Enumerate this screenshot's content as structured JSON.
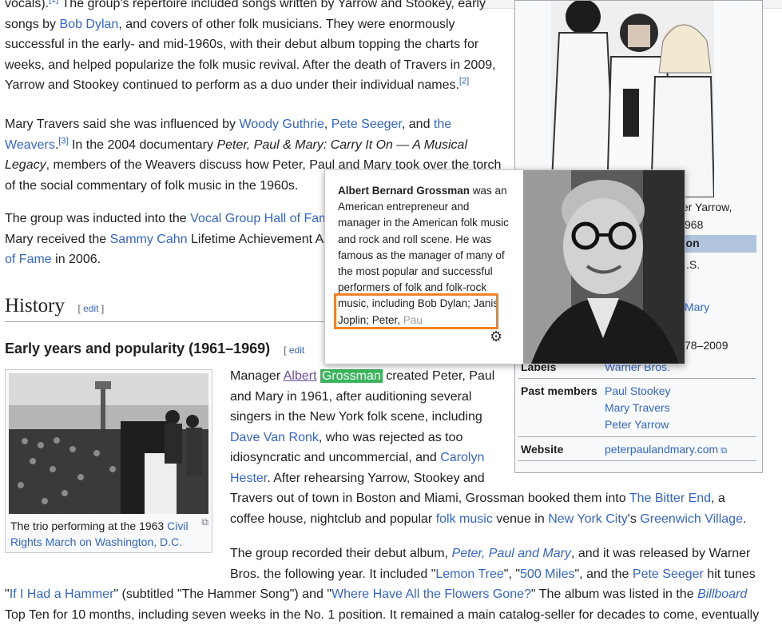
{
  "article": {
    "p1_top": "vocals).",
    "p1_top_rest": "The group's repertoire included songs written by Yarrow and Stookey, early",
    "p1_songs_by": "songs by",
    "p1_bob_dylan": "Bob Dylan",
    "p1_line2_rest": ", and covers of other folk musicians. They were enormously",
    "p1_line3": "successful in the early- and mid-1960s, with their debut album topping the charts for",
    "p1_line4": "weeks, and helped popularize the folk music revival. After the death of Travers in 2009,",
    "p1_line5": "Yarrow and Stookey continued to perform as a duo under their individual names.",
    "ref2": "[2]",
    "p2_start": "Mary Travers said she was influenced by",
    "p2_woody": "Woody Guthrie",
    "p2_comma": ",",
    "p2_pete": "Pete Seeger",
    "p2_and": ", and",
    "p2_the": "the",
    "p2_weavers": "Weavers",
    "ref3": "[3]",
    "p2_line2_rest": " In the 2004 documentary",
    "p2_doc_title": "Peter, Paul & Mary: Carry It On — A Musical",
    "p2_legacy": "Legacy",
    "p2_line3_rest": ", members of the Weavers discuss how Peter, Paul and Mary took over the torch",
    "p2_line4": "of the social commentary of folk music in the 1960s.",
    "p3_start": "The group was inducted into the",
    "p3_vocal": "Vocal Group Hall of Fam",
    "p3_line2_start": "Mary received the",
    "p3_sammy": "Sammy Cahn",
    "p3_line2_rest": " Lifetime Achievement A",
    "p3_of_fame": "of Fame",
    "p3_line3_rest": " in 2006.",
    "history_heading": "History",
    "edit_label": "edit",
    "subheading": "Early years and popularity (1961–1969)",
    "p4_manager": "Manager",
    "p4_albert": "Albert",
    "p4_grossman": "Grossman",
    "p4_line1_rest": " created Peter, Paul",
    "p4_line2": "and Mary in 1961, after auditioning several",
    "p4_line3": "singers in the New York folk scene, including",
    "p4_dave": "Dave Van Ronk",
    "p4_line4_rest": ", who was rejected as too",
    "p4_line5": "idiosyncratic and uncommercial, and",
    "p4_carolyn": "Carolyn",
    "p4_hester": "Hester",
    "p4_line6_rest": ". After rehearsing Yarrow, Stookey and",
    "p4_line7_start": "Travers out of town in Boston and Miami, Grossman booked them into",
    "p4_bitter": "The Bitter End",
    "p4_line7_end": ", a",
    "p4_line8_start": "coffee house, nightclub and popular",
    "p4_folk": "folk music",
    "p4_venue": " venue in",
    "p4_nyc": "New York City",
    "p4_s": "'s",
    "p4_greenwich": "Greenwich Village",
    "p4_dot": ".",
    "p5_start": "The group recorded their debut album,",
    "p5_album": "Peter, Paul and Mary",
    "p5_line1_rest": ", and it was released by Warner",
    "p5_line2_start": "Bros. the following year. It included \"",
    "p5_lemon": "Lemon Tree",
    "p5_q1": "\", \"",
    "p5_500": "500 Miles",
    "p5_q2": "\", and the",
    "p5_pete": "Pete Seeger",
    "p5_hit": " hit tunes",
    "p5_q3": "\"",
    "p5_hammer": "If I Had a Hammer",
    "p5_sub": "\" (subtitled \"The Hammer Song\") and \"",
    "p5_flowers": "Where Have All the Flowers Gone?",
    "p5_q4": "\" The album was listed in the",
    "p5_billboard": "Billboard",
    "p5_line4": "Top Ten for 10 months, including seven weeks in the No. 1 position. It remained a main catalog-seller for decades to come, eventually"
  },
  "thumb": {
    "caption_start": "The trio performing at the 1963",
    "caption_link": "Civil Rights March on Washington, D.C.",
    "magnify_icon": "magnify-clip"
  },
  "infobox": {
    "caption_frag1": "ter Yarrow,",
    "caption_frag2": "968",
    "section_frag": "tion",
    "frag_s": ".S.",
    "frag_mary": "Mary",
    "frag_years": "78–2009",
    "labels_label": "Labels",
    "labels_value": "Warner Bros.",
    "past_members_label": "Past members",
    "past_members": [
      "Paul Stookey",
      "Mary Travers",
      "Peter Yarrow"
    ],
    "website_label": "Website",
    "website_value": "peterpaulandmary.com"
  },
  "popup": {
    "name": "Albert Bernard Grossman",
    "text1": " was an American entrepreneur and manager in the American folk music and rock and roll scene. He was famous as the manager of many of the most popular and successful performers of folk and ",
    "text2": "folk-rock music, including Bob Dylan; Janis Joplin; Peter, ",
    "text_faded": "Pau",
    "settings_icon": "gear"
  },
  "colors": {
    "link": "#3366cc",
    "visited": "#6b4ba1",
    "highlight": "#3bb55d",
    "annotation_box": "#f0822a"
  }
}
